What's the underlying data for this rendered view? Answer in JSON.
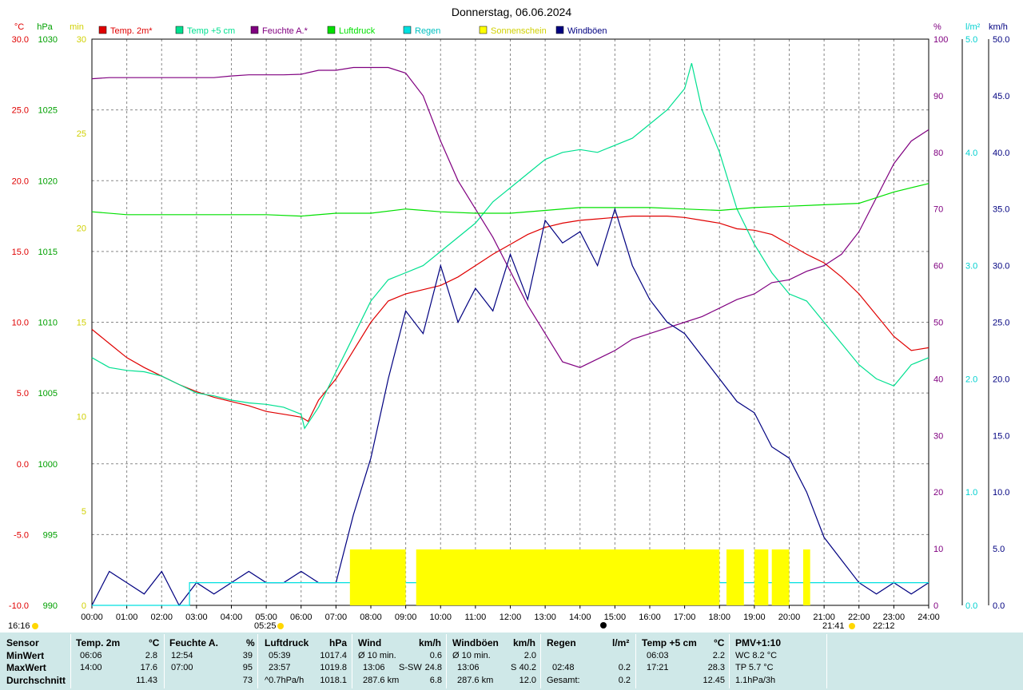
{
  "chart_data": {
    "type": "line",
    "title": "Donnerstag, 06.06.2024",
    "x_ticks": [
      "00:00",
      "01:00",
      "02:00",
      "03:00",
      "04:00",
      "05:00",
      "06:00",
      "07:00",
      "08:00",
      "09:00",
      "10:00",
      "11:00",
      "12:00",
      "13:00",
      "14:00",
      "15:00",
      "16:00",
      "17:00",
      "18:00",
      "19:00",
      "20:00",
      "21:00",
      "22:00",
      "23:00",
      "24:00"
    ],
    "axes": {
      "temp": {
        "unit": "°C",
        "range": [
          -10,
          30
        ],
        "ticks": [
          "30.0",
          "25.0",
          "20.0",
          "15.0",
          "10.0",
          "5.0",
          "0.0",
          "-5.0",
          "-10.0"
        ]
      },
      "pressure": {
        "unit": "hPa",
        "range": [
          990,
          1030
        ],
        "ticks": [
          "1030",
          "1025",
          "1020",
          "1015",
          "1010",
          "1005",
          "1000",
          "995",
          "990"
        ]
      },
      "sun_minutes": {
        "unit": "min",
        "range": [
          0,
          30
        ],
        "ticks": [
          "30",
          "25",
          "20",
          "15",
          "10",
          "5",
          "0"
        ]
      },
      "humidity": {
        "unit": "%",
        "range": [
          0,
          100
        ],
        "ticks": [
          "100",
          "90",
          "80",
          "70",
          "60",
          "50",
          "40",
          "30",
          "20",
          "10",
          "0"
        ]
      },
      "rain": {
        "unit": "l/m²",
        "range": [
          0,
          5
        ],
        "ticks": [
          "5.0",
          "4.0",
          "3.0",
          "2.0",
          "1.0",
          "0.0"
        ]
      },
      "wind": {
        "unit": "km/h",
        "range": [
          0,
          50
        ],
        "ticks": [
          "50.0",
          "45.0",
          "40.0",
          "35.0",
          "30.0",
          "25.0",
          "20.0",
          "15.0",
          "10.0",
          "5.0",
          "0.0"
        ]
      }
    },
    "legend": [
      {
        "name": "Temp. 2m*",
        "color": "#e00000"
      },
      {
        "name": "Temp +5 cm",
        "color": "#00e090"
      },
      {
        "name": "Feuchte A.*",
        "color": "#800080"
      },
      {
        "name": "Luftdruck",
        "color": "#00e000"
      },
      {
        "name": "Regen",
        "color": "#00e0e0"
      },
      {
        "name": "Sonnenschein",
        "color": "#ffff00"
      },
      {
        "name": "Windböen",
        "color": "#000080"
      }
    ],
    "series": [
      {
        "name": "Temp. 2m*",
        "axis": "temp",
        "color": "#e00000",
        "x": [
          0,
          0.5,
          1,
          1.5,
          2,
          2.5,
          3,
          3.5,
          4,
          4.5,
          5,
          5.5,
          6,
          6.2,
          6.5,
          7,
          7.5,
          8,
          8.5,
          9,
          9.5,
          10,
          10.5,
          11,
          11.5,
          12,
          12.5,
          13,
          13.5,
          14,
          14.5,
          15,
          15.5,
          16,
          16.5,
          17,
          17.5,
          18,
          18.5,
          19,
          19.5,
          20,
          20.5,
          21,
          21.5,
          22,
          22.5,
          23,
          23.5,
          24
        ],
        "y": [
          9.5,
          8.5,
          7.5,
          6.8,
          6.2,
          5.6,
          5.1,
          4.7,
          4.4,
          4.1,
          3.7,
          3.5,
          3.3,
          3.0,
          4.5,
          6.0,
          8.0,
          10.0,
          11.5,
          12.0,
          12.3,
          12.6,
          13.2,
          14.0,
          14.8,
          15.5,
          16.2,
          16.7,
          17.0,
          17.2,
          17.3,
          17.4,
          17.5,
          17.5,
          17.5,
          17.4,
          17.2,
          17.0,
          16.6,
          16.5,
          16.2,
          15.5,
          14.8,
          14.2,
          13.2,
          12.0,
          10.5,
          9.0,
          8.0,
          8.2
        ]
      },
      {
        "name": "Temp +5 cm",
        "axis": "temp",
        "color": "#00e090",
        "x": [
          0,
          0.5,
          1,
          1.5,
          2,
          2.5,
          3,
          3.5,
          4,
          4.5,
          5,
          5.5,
          6,
          6.1,
          6.5,
          7,
          7.5,
          8,
          8.5,
          9,
          9.5,
          10,
          10.5,
          11,
          11.5,
          12,
          12.5,
          13,
          13.5,
          14,
          14.5,
          15,
          15.5,
          16,
          16.5,
          17,
          17.2,
          17.5,
          18,
          18.5,
          19,
          19.5,
          20,
          20.5,
          21,
          21.5,
          22,
          22.5,
          23,
          23.5,
          24
        ],
        "y": [
          7.5,
          6.8,
          6.6,
          6.5,
          6.2,
          5.6,
          5.0,
          4.8,
          4.5,
          4.3,
          4.2,
          4.0,
          3.5,
          2.5,
          4.0,
          6.5,
          9.0,
          11.5,
          13.0,
          13.5,
          14.0,
          15.0,
          16.0,
          17.0,
          18.5,
          19.5,
          20.5,
          21.5,
          22.0,
          22.2,
          22.0,
          22.5,
          23.0,
          24.0,
          25.0,
          26.5,
          28.3,
          25.0,
          22.0,
          18.0,
          15.5,
          13.5,
          12.0,
          11.5,
          10.0,
          8.5,
          7.0,
          6.0,
          5.5,
          7.0,
          7.5
        ]
      },
      {
        "name": "Feuchte A.*",
        "axis": "humidity",
        "color": "#800080",
        "x": [
          0,
          0.5,
          1,
          1.5,
          2,
          2.5,
          3,
          3.5,
          4,
          4.5,
          5,
          5.5,
          6,
          6.5,
          7,
          7.5,
          8,
          8.5,
          9,
          9.5,
          10,
          10.5,
          11,
          11.5,
          12,
          12.5,
          13,
          13.5,
          14,
          14.5,
          15,
          15.5,
          16,
          16.5,
          17,
          17.5,
          18,
          18.5,
          19,
          19.5,
          20,
          20.5,
          21,
          21.5,
          22,
          22.5,
          23,
          23.5,
          24
        ],
        "y": [
          93,
          93.2,
          93.2,
          93.2,
          93.2,
          93.2,
          93.2,
          93.2,
          93.5,
          93.7,
          93.7,
          93.7,
          93.8,
          94.5,
          94.5,
          95,
          95,
          95,
          94,
          90,
          82,
          75,
          70,
          65,
          59,
          53,
          48,
          43,
          42,
          43.5,
          45,
          47,
          48,
          49,
          50,
          51,
          52.5,
          54,
          55,
          57,
          57.5,
          59,
          60,
          62,
          66,
          72,
          78,
          82,
          84
        ]
      },
      {
        "name": "Luftdruck",
        "axis": "pressure",
        "color": "#00e000",
        "x": [
          0,
          1,
          2,
          3,
          4,
          5,
          6,
          7,
          8,
          9,
          10,
          11,
          12,
          13,
          14,
          15,
          16,
          17,
          18,
          19,
          20,
          21,
          22,
          23,
          24
        ],
        "y": [
          1017.8,
          1017.6,
          1017.6,
          1017.6,
          1017.6,
          1017.6,
          1017.5,
          1017.7,
          1017.7,
          1018.0,
          1017.8,
          1017.7,
          1017.7,
          1017.9,
          1018.1,
          1018.1,
          1018.1,
          1018.0,
          1017.9,
          1018.1,
          1018.2,
          1018.3,
          1018.4,
          1019.2,
          1019.8
        ]
      },
      {
        "name": "Windböen",
        "axis": "wind",
        "color": "#000080",
        "x": [
          0,
          0.5,
          1,
          1.5,
          2,
          2.5,
          3,
          3.5,
          4,
          4.5,
          5,
          5.5,
          6,
          6.5,
          7,
          7.5,
          8,
          8.5,
          9,
          9.5,
          10,
          10.5,
          11,
          11.5,
          12,
          12.5,
          13,
          13.5,
          14,
          14.5,
          15,
          15.5,
          16,
          16.5,
          17,
          17.5,
          18,
          18.5,
          19,
          19.5,
          20,
          20.5,
          21,
          21.5,
          22,
          22.5,
          23,
          23.5,
          24
        ],
        "y": [
          0,
          3,
          2,
          1,
          3,
          0,
          2,
          1,
          2,
          3,
          2,
          2,
          3,
          2,
          2,
          8,
          13,
          20,
          26,
          24,
          30,
          25,
          28,
          26,
          31,
          27,
          34,
          32,
          33,
          30,
          35,
          30,
          27,
          25,
          24,
          22,
          20,
          18,
          17,
          14,
          13,
          10,
          6,
          4,
          2,
          1,
          2,
          1,
          2
        ]
      },
      {
        "name": "Regen",
        "axis": "rain",
        "color": "#00e0e0",
        "x": [
          0,
          2.8,
          2.8,
          24
        ],
        "y": [
          0,
          0,
          0.2,
          0.2
        ]
      },
      {
        "name": "Sonnenschein",
        "axis": "sun_minutes",
        "color": "#ffff00",
        "intervals": [
          [
            7.4,
            9.0
          ],
          [
            9.3,
            18.0
          ],
          [
            18.2,
            18.7
          ],
          [
            19.0,
            19.4
          ],
          [
            19.5,
            20.0
          ],
          [
            20.4,
            20.6
          ]
        ]
      }
    ]
  },
  "bottom_markers": {
    "time_left": "16:16",
    "sunrise": "05:25",
    "sunset": "21:41",
    "moon": "22:12"
  },
  "stats": {
    "row_labels": [
      "Sensor",
      "MinWert",
      "MaxWert",
      "Durchschnitt"
    ],
    "temp2m": {
      "header": "Temp. 2m",
      "unit": "°C",
      "min_time": "06:06",
      "min": "2.8",
      "max_time": "14:00",
      "max": "17.6",
      "avg": "11.43"
    },
    "humidity": {
      "header": "Feuchte A.",
      "unit": "%",
      "min_time": "12:54",
      "min": "39",
      "max_time": "07:00",
      "max": "95",
      "avg": "73"
    },
    "pressure": {
      "header": "Luftdruck",
      "unit": "hPa",
      "min_time": "05:39",
      "min": "1017.4",
      "max_time": "23:57",
      "max": "1019.8",
      "trend": "^0.7hPa/h",
      "avg": "1018.1"
    },
    "wind": {
      "header": "Wind",
      "unit": "km/h",
      "min_label": "Ø 10 min.",
      "min": "0.6",
      "max_time": "13:06",
      "max_dir": "S-SW",
      "max": "24.8",
      "dist": "287.6 km",
      "avg": "6.8"
    },
    "gusts": {
      "header": "Windböen",
      "unit": "km/h",
      "min_label": "Ø 10 min.",
      "min": "2.0",
      "max_time": "13:06",
      "max_dir": "S",
      "max": "40.2",
      "dist": "287.6 km",
      "avg": "12.0"
    },
    "rain": {
      "header": "Regen",
      "unit": "l/m²",
      "max_time": "02:48",
      "max": "0.2",
      "total_label": "Gesamt:",
      "total": "0.2"
    },
    "temp5cm": {
      "header": "Temp +5 cm",
      "unit": "°C",
      "min_time": "06:03",
      "min": "2.2",
      "max_time": "17:21",
      "max": "28.3",
      "avg": "12.45"
    },
    "pmv": {
      "header": "PMV+1:10",
      "wc": "WC 8.2 °C",
      "tp": "TP 5.7 °C",
      "trend": "1.1hPa/3h"
    }
  }
}
